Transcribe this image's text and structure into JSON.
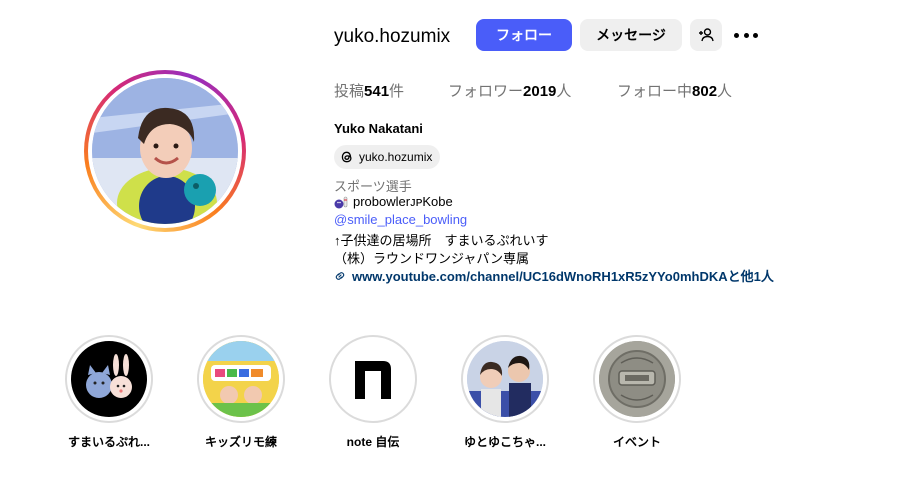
{
  "profile": {
    "username": "yuko.hozumix",
    "follow_label": "フォロー",
    "message_label": "メッセージ",
    "stats": {
      "posts_prefix": "投稿",
      "posts_count": "541",
      "posts_suffix": "件",
      "followers_prefix": "フォロワー",
      "followers_count": "2019",
      "followers_suffix": "人",
      "following_prefix": "フォロー中",
      "following_count": "802",
      "following_suffix": "人"
    },
    "full_name": "Yuko Nakatani",
    "threads_handle": "yuko.hozumix",
    "category": "スポーツ選手",
    "bio": {
      "line1": "probowlerᴊᴘKobe",
      "mention": "@smile_place_bowling",
      "line3": "↑子供達の居場所　すまいるぷれいす",
      "line4": "（株）ラウンドワンジャパン専属",
      "link": "www.youtube.com/channel/UC16dWnoRH1xR5zYYo0mhDKAと他1人"
    }
  },
  "highlights": [
    {
      "label": "すまいるぷれ..."
    },
    {
      "label": "キッズリモ練"
    },
    {
      "label": "note 自伝"
    },
    {
      "label": "ゆとゆこちゃ..."
    },
    {
      "label": "イベント"
    }
  ],
  "colors": {
    "accent": "#4a5df9",
    "link": "#00376b",
    "muted": "#737373",
    "button_bg": "#efefef"
  }
}
